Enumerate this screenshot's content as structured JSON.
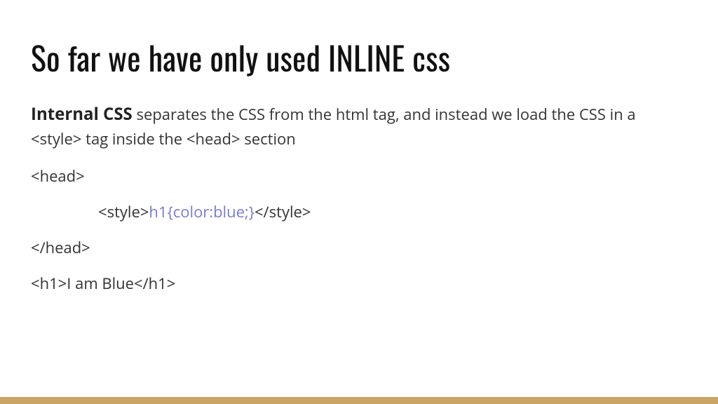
{
  "title": "So far we have only used INLINE css",
  "intro": {
    "bold": "Internal CSS",
    "rest": " separates the CSS from the html tag, and instead we load the CSS in a <style> tag inside the <head> section"
  },
  "code": {
    "line1": "<head>",
    "line2_open": "<style>",
    "line2_css": "h1{color:blue;}",
    "line2_close": "</style>",
    "line3": "</head>",
    "line4": "<h1>I am Blue</h1>"
  }
}
